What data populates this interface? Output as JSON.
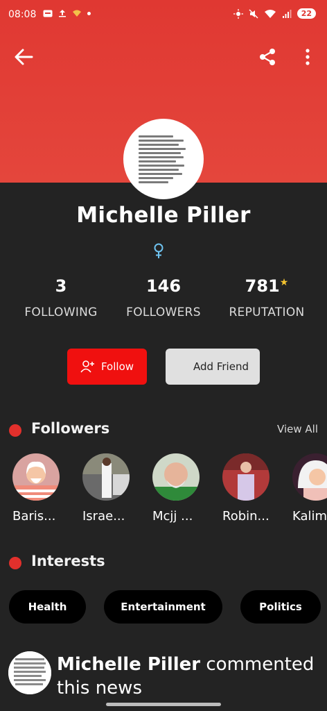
{
  "status_bar": {
    "time": "08:08",
    "battery": "22"
  },
  "header": {
    "back_icon": "arrow-left-icon",
    "share_icon": "share-icon",
    "more_icon": "more-vert-icon"
  },
  "profile": {
    "name": "Michelle Piller",
    "gender_icon": "female-icon"
  },
  "stats": [
    {
      "value": "3",
      "label": "FOLLOWING"
    },
    {
      "value": "146",
      "label": "FOLLOWERS"
    },
    {
      "value": "781",
      "label": "REPUTATION"
    }
  ],
  "actions": {
    "follow_label": "Follow",
    "add_friend_label": "Add Friend"
  },
  "followers_section": {
    "title": "Followers",
    "view_all": "View All",
    "items": [
      {
        "name": "Baris..."
      },
      {
        "name": "Israe..."
      },
      {
        "name": "Mcjj ..."
      },
      {
        "name": "Robin..."
      },
      {
        "name": "Kalim"
      }
    ]
  },
  "interests_section": {
    "title": "Interests",
    "chips": [
      "Health",
      "Entertainment",
      "Politics"
    ]
  },
  "activity": {
    "actor": "Michelle Piller",
    "text": " commented this news"
  },
  "colors": {
    "accent": "#e03832",
    "follow_button": "#f0100f",
    "background": "#232323",
    "star": "#f4c430"
  }
}
